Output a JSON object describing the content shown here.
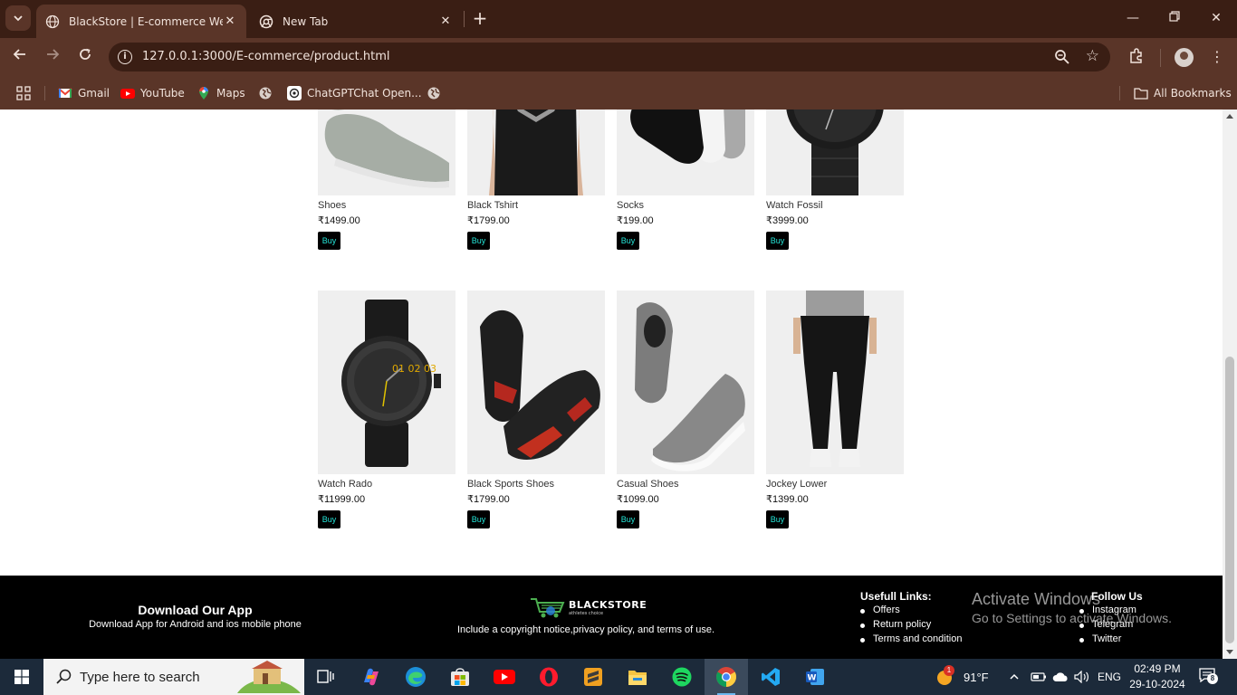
{
  "browser": {
    "tabs": [
      {
        "title": "BlackStore | E-commerce Website",
        "active": true
      },
      {
        "title": "New Tab",
        "active": false
      }
    ],
    "url": "127.0.0.1:3000/E-commerce/product.html",
    "bookmarks": [
      {
        "label": "Gmail",
        "icon": "gmail-icon"
      },
      {
        "label": "YouTube",
        "icon": "youtube-icon"
      },
      {
        "label": "Maps",
        "icon": "maps-icon"
      },
      {
        "label": "",
        "icon": "globe-icon"
      },
      {
        "label": "ChatGPTChat Open...",
        "icon": "chatgpt-icon"
      },
      {
        "label": "",
        "icon": "globe-icon"
      }
    ],
    "all_bookmarks": "All Bookmarks"
  },
  "products": {
    "row1": [
      {
        "name": "Shoes",
        "price": "₹1499.00",
        "buy": "Buy"
      },
      {
        "name": "Black Tshirt",
        "price": "₹1799.00",
        "buy": "Buy"
      },
      {
        "name": "Socks",
        "price": "₹199.00",
        "buy": "Buy"
      },
      {
        "name": "Watch Fossil",
        "price": "₹3999.00",
        "buy": "Buy"
      }
    ],
    "row2": [
      {
        "name": "Watch Rado",
        "price": "₹11999.00",
        "buy": "Buy"
      },
      {
        "name": "Black Sports Shoes",
        "price": "₹1799.00",
        "buy": "Buy"
      },
      {
        "name": "Casual Shoes",
        "price": "₹1099.00",
        "buy": "Buy"
      },
      {
        "name": "Jockey Lower",
        "price": "₹1399.00",
        "buy": "Buy"
      }
    ]
  },
  "footer": {
    "download_title": "Download Our App",
    "download_sub": "Download App for Android and ios mobile phone",
    "logo_text": "BLACKSTORE",
    "logo_tagline": "athletes choice",
    "copyright": "Include a copyright notice,privacy policy, and terms of use.",
    "useful_title": "Usefull Links:",
    "useful_links": [
      "Offers",
      "Return policy",
      "Terms and condition"
    ],
    "follow_title": "Follow Us",
    "follow_links": [
      "Instagram",
      "Telegram",
      "Twitter"
    ]
  },
  "watermark": {
    "line1": "Activate Windows",
    "line2": "Go to Settings to activate Windows."
  },
  "taskbar": {
    "search_placeholder": "Type here to search",
    "weather": "91°F",
    "weather_badge": "1",
    "language": "ENG",
    "time": "02:49 PM",
    "date": "29-10-2024",
    "notifications": "8"
  },
  "colors": {
    "chrome_dark": "#3a1e14",
    "chrome_mid": "#5a3528",
    "buy_text": "#25e6d9",
    "footer_bg": "#000000"
  }
}
